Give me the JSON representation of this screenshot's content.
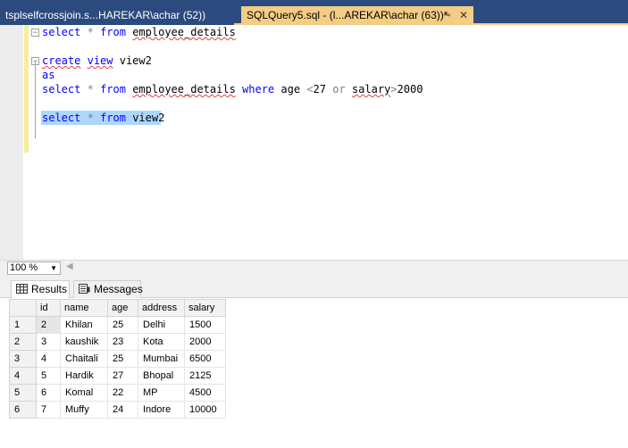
{
  "tabs": [
    {
      "label": "tsplselfcrossjoin.s...HAREKAR\\achar (52))"
    },
    {
      "label": "SQLQuery5.sql - (l...AREKAR\\achar (63))*"
    }
  ],
  "editor": {
    "line1": {
      "kw1": "select",
      "op": "*",
      "kw2": "from",
      "ident": "employee_details"
    },
    "line2": {
      "kw1": "create",
      "kw2": "view",
      "ident": "view2"
    },
    "line3": {
      "kw1": "as"
    },
    "line4": {
      "kw1": "select",
      "op": "*",
      "kw2": "from",
      "ident": "employee_details",
      "kw3": "where",
      "col1": "age",
      "op2": "<",
      "num1": "27",
      "kw4": "or",
      "col2": "salary",
      "op3": ">",
      "num2": "2000"
    },
    "line5": {
      "kw1": "select",
      "op": "*",
      "kw2": "from",
      "ident": "view2"
    }
  },
  "zoom": {
    "value": "100 %"
  },
  "results_tabs": {
    "results": "Results",
    "messages": "Messages"
  },
  "grid": {
    "columns": [
      "id",
      "name",
      "age",
      "address",
      "salary"
    ],
    "rows": [
      [
        "1",
        "2",
        "Khilan",
        "25",
        "Delhi",
        "1500"
      ],
      [
        "2",
        "3",
        "kaushik",
        "23",
        "Kota",
        "2000"
      ],
      [
        "3",
        "4",
        "Chaitali",
        "25",
        "Mumbai",
        "6500"
      ],
      [
        "4",
        "5",
        "Hardik",
        "27",
        "Bhopal",
        "2125"
      ],
      [
        "5",
        "6",
        "Komal",
        "22",
        "MP",
        "4500"
      ],
      [
        "6",
        "7",
        "Muffy",
        "24",
        "Indore",
        "10000"
      ]
    ]
  },
  "colors": {
    "tabbar": "#2b4a7e",
    "active_tab": "#f5cc84",
    "keyword": "#0000ff",
    "selection": "#add6ff"
  },
  "icons": {
    "pin": "pin-icon",
    "close": "close-icon",
    "results": "grid-icon",
    "messages": "messages-icon"
  }
}
